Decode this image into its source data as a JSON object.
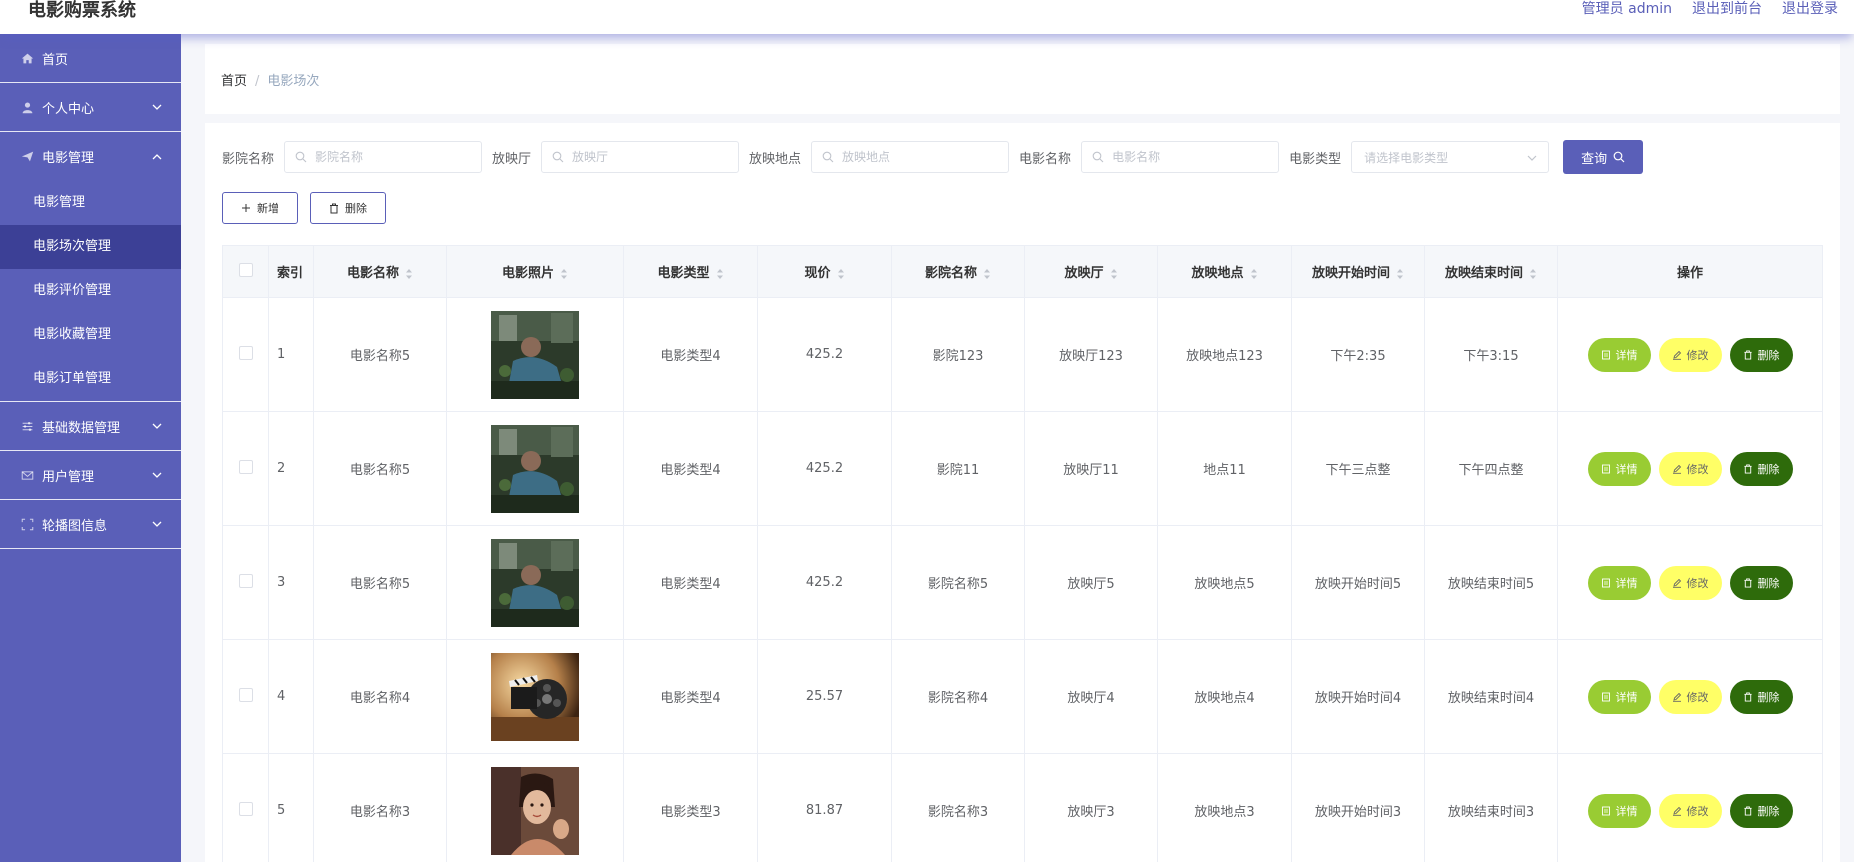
{
  "header": {
    "brand": "电影购票系统",
    "admin_label": "管理员 admin",
    "exit_front_label": "退出到前台",
    "logout_label": "退出登录"
  },
  "sidebar": {
    "home": "首页",
    "personal": "个人中心",
    "movie_mgmt": "电影管理",
    "sub_items": [
      "电影管理",
      "电影场次管理",
      "电影评价管理",
      "电影收藏管理",
      "电影订单管理"
    ],
    "active_sub": "电影场次管理",
    "basic_data": "基础数据管理",
    "user_mgmt": "用户管理",
    "carousel": "轮播图信息"
  },
  "breadcrumb": {
    "home": "首页",
    "separator": "/",
    "current": "电影场次"
  },
  "search": {
    "cinema_label": "影院名称",
    "cinema_placeholder": "影院名称",
    "hall_label": "放映厅",
    "hall_placeholder": "放映厅",
    "location_label": "放映地点",
    "location_placeholder": "放映地点",
    "movie_label": "电影名称",
    "movie_placeholder": "电影名称",
    "type_label": "电影类型",
    "type_placeholder": "请选择电影类型",
    "query_label": "查询"
  },
  "actions": {
    "add_label": "新增",
    "delete_label": "删除"
  },
  "table": {
    "columns": [
      "索引",
      "电影名称",
      "电影照片",
      "电影类型",
      "现价",
      "影院名称",
      "放映厅",
      "放映地点",
      "放映开始时间",
      "放映结束时间",
      "操作"
    ],
    "row_actions": {
      "detail": "详情",
      "edit": "修改",
      "delete": "删除"
    },
    "rows": [
      {
        "index": "1",
        "movie": "电影名称5",
        "photo": "movie-still-garden",
        "type": "电影类型4",
        "price": "425.2",
        "cinema": "影院123",
        "hall": "放映厅123",
        "location": "放映地点123",
        "start": "下午2:35",
        "end": "下午3:15"
      },
      {
        "index": "2",
        "movie": "电影名称5",
        "photo": "movie-still-garden",
        "type": "电影类型4",
        "price": "425.2",
        "cinema": "影院11",
        "hall": "放映厅11",
        "location": "地点11",
        "start": "下午三点整",
        "end": "下午四点整"
      },
      {
        "index": "3",
        "movie": "电影名称5",
        "photo": "movie-still-garden",
        "type": "电影类型4",
        "price": "425.2",
        "cinema": "影院名称5",
        "hall": "放映厅5",
        "location": "放映地点5",
        "start": "放映开始时间5",
        "end": "放映结束时间5"
      },
      {
        "index": "4",
        "movie": "电影名称4",
        "photo": "film-reel-clapper",
        "type": "电影类型4",
        "price": "25.57",
        "cinema": "影院名称4",
        "hall": "放映厅4",
        "location": "放映地点4",
        "start": "放映开始时间4",
        "end": "放映结束时间4"
      },
      {
        "index": "5",
        "movie": "电影名称3",
        "photo": "movie-still-portrait",
        "type": "电影类型3",
        "price": "81.87",
        "cinema": "影院名称3",
        "hall": "放映厅3",
        "location": "放映地点3",
        "start": "放映开始时间3",
        "end": "放映结束时间3"
      }
    ]
  },
  "colors": {
    "primary": "#5a5fb8",
    "sidebar_active": "#3c4096",
    "detail_btn": "#99cc33",
    "edit_btn": "#ffff66",
    "delete_btn": "#2e6b0b"
  }
}
